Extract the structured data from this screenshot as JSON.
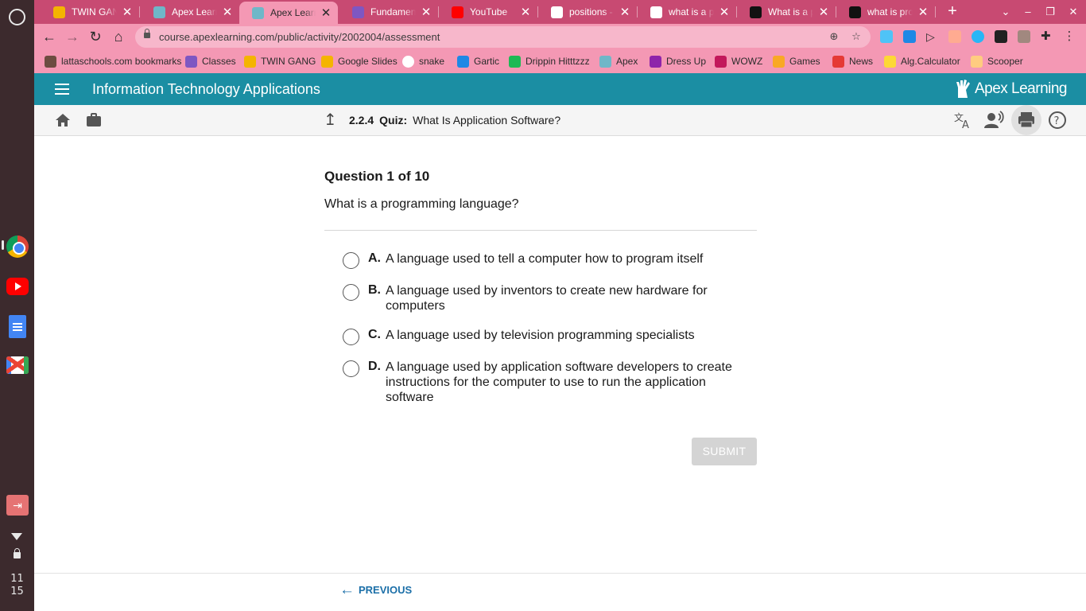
{
  "browser": {
    "tabs": [
      {
        "title": "TWIN GANG -",
        "favicon": "slides-icon",
        "color": "#f4b400"
      },
      {
        "title": "Apex Learning",
        "favicon": "apex-icon",
        "color": "#6fb7c8"
      },
      {
        "title": "Apex Learning",
        "favicon": "apex-icon",
        "color": "#6fb7c8"
      },
      {
        "title": "Fundamental",
        "favicon": "classroom-icon",
        "color": "#7e57c2"
      },
      {
        "title": "YouTube",
        "favicon": "youtube-icon",
        "color": "#ff0000"
      },
      {
        "title": "positions - Go",
        "favicon": "google-icon",
        "color": "#ffffff"
      },
      {
        "title": "what is a prog",
        "favicon": "google-icon",
        "color": "#ffffff"
      },
      {
        "title": "What is a pro",
        "favicon": "brainly-icon",
        "color": "#111111"
      },
      {
        "title": "what is progr",
        "favicon": "brainly-icon",
        "color": "#111111"
      }
    ],
    "active_tab": 2,
    "url": "course.apexlearning.com/public/activity/2002004/assessment",
    "bookmarks": [
      {
        "label": "lattaschools.com bookmarks",
        "icon": "folder-icon",
        "color": "#6d4c41"
      },
      {
        "label": "Classes",
        "icon": "classroom-icon",
        "color": "#7e57c2"
      },
      {
        "label": "TWIN GANG",
        "icon": "slides-icon",
        "color": "#f4b400"
      },
      {
        "label": "Google Slides",
        "icon": "slides-icon",
        "color": "#f4b400"
      },
      {
        "label": "snake",
        "icon": "google-icon",
        "color": "#ffffff"
      },
      {
        "label": "Gartic",
        "icon": "gartic-icon",
        "color": "#1e88e5"
      },
      {
        "label": "Drippin Hitttzzz",
        "icon": "spotify-icon",
        "color": "#1db954"
      },
      {
        "label": "Apex",
        "icon": "apex-icon",
        "color": "#6fb7c8"
      },
      {
        "label": "Dress Up",
        "icon": "dressup-icon",
        "color": "#8e24aa"
      },
      {
        "label": "WOWZ",
        "icon": "wowz-icon",
        "color": "#c2185b"
      },
      {
        "label": "Games",
        "icon": "games-icon",
        "color": "#f9a825"
      },
      {
        "label": "News",
        "icon": "news-icon",
        "color": "#e53935"
      },
      {
        "label": "Alg.Calculator",
        "icon": "calculator-icon",
        "color": "#fdd835"
      },
      {
        "label": "Scooper",
        "icon": "scooper-icon",
        "color": "#ffcc80"
      }
    ]
  },
  "shelf": {
    "clock_hour": "11",
    "clock_minute": "15"
  },
  "app": {
    "course_title": "Information Technology Applications",
    "logo_text": "Apex Learning",
    "accent_color": "#1b8ea3"
  },
  "breadcrumb": {
    "number": "2.2.4",
    "kind": "Quiz:",
    "title": "What Is Application Software?"
  },
  "quiz": {
    "progress": "Question 1 of 10",
    "question": "What is a programming language?",
    "options": [
      {
        "letter": "A.",
        "text": "A language used to tell a computer how to program itself"
      },
      {
        "letter": "B.",
        "text": "A language used by inventors to create new hardware for computers"
      },
      {
        "letter": "C.",
        "text": "A language used by television programming specialists"
      },
      {
        "letter": "D.",
        "text": "A language used by application software developers to create instructions for the computer to use to run the application software"
      }
    ],
    "submit_label": "SUBMIT",
    "submit_enabled": false
  },
  "footer": {
    "previous_label": "PREVIOUS"
  }
}
